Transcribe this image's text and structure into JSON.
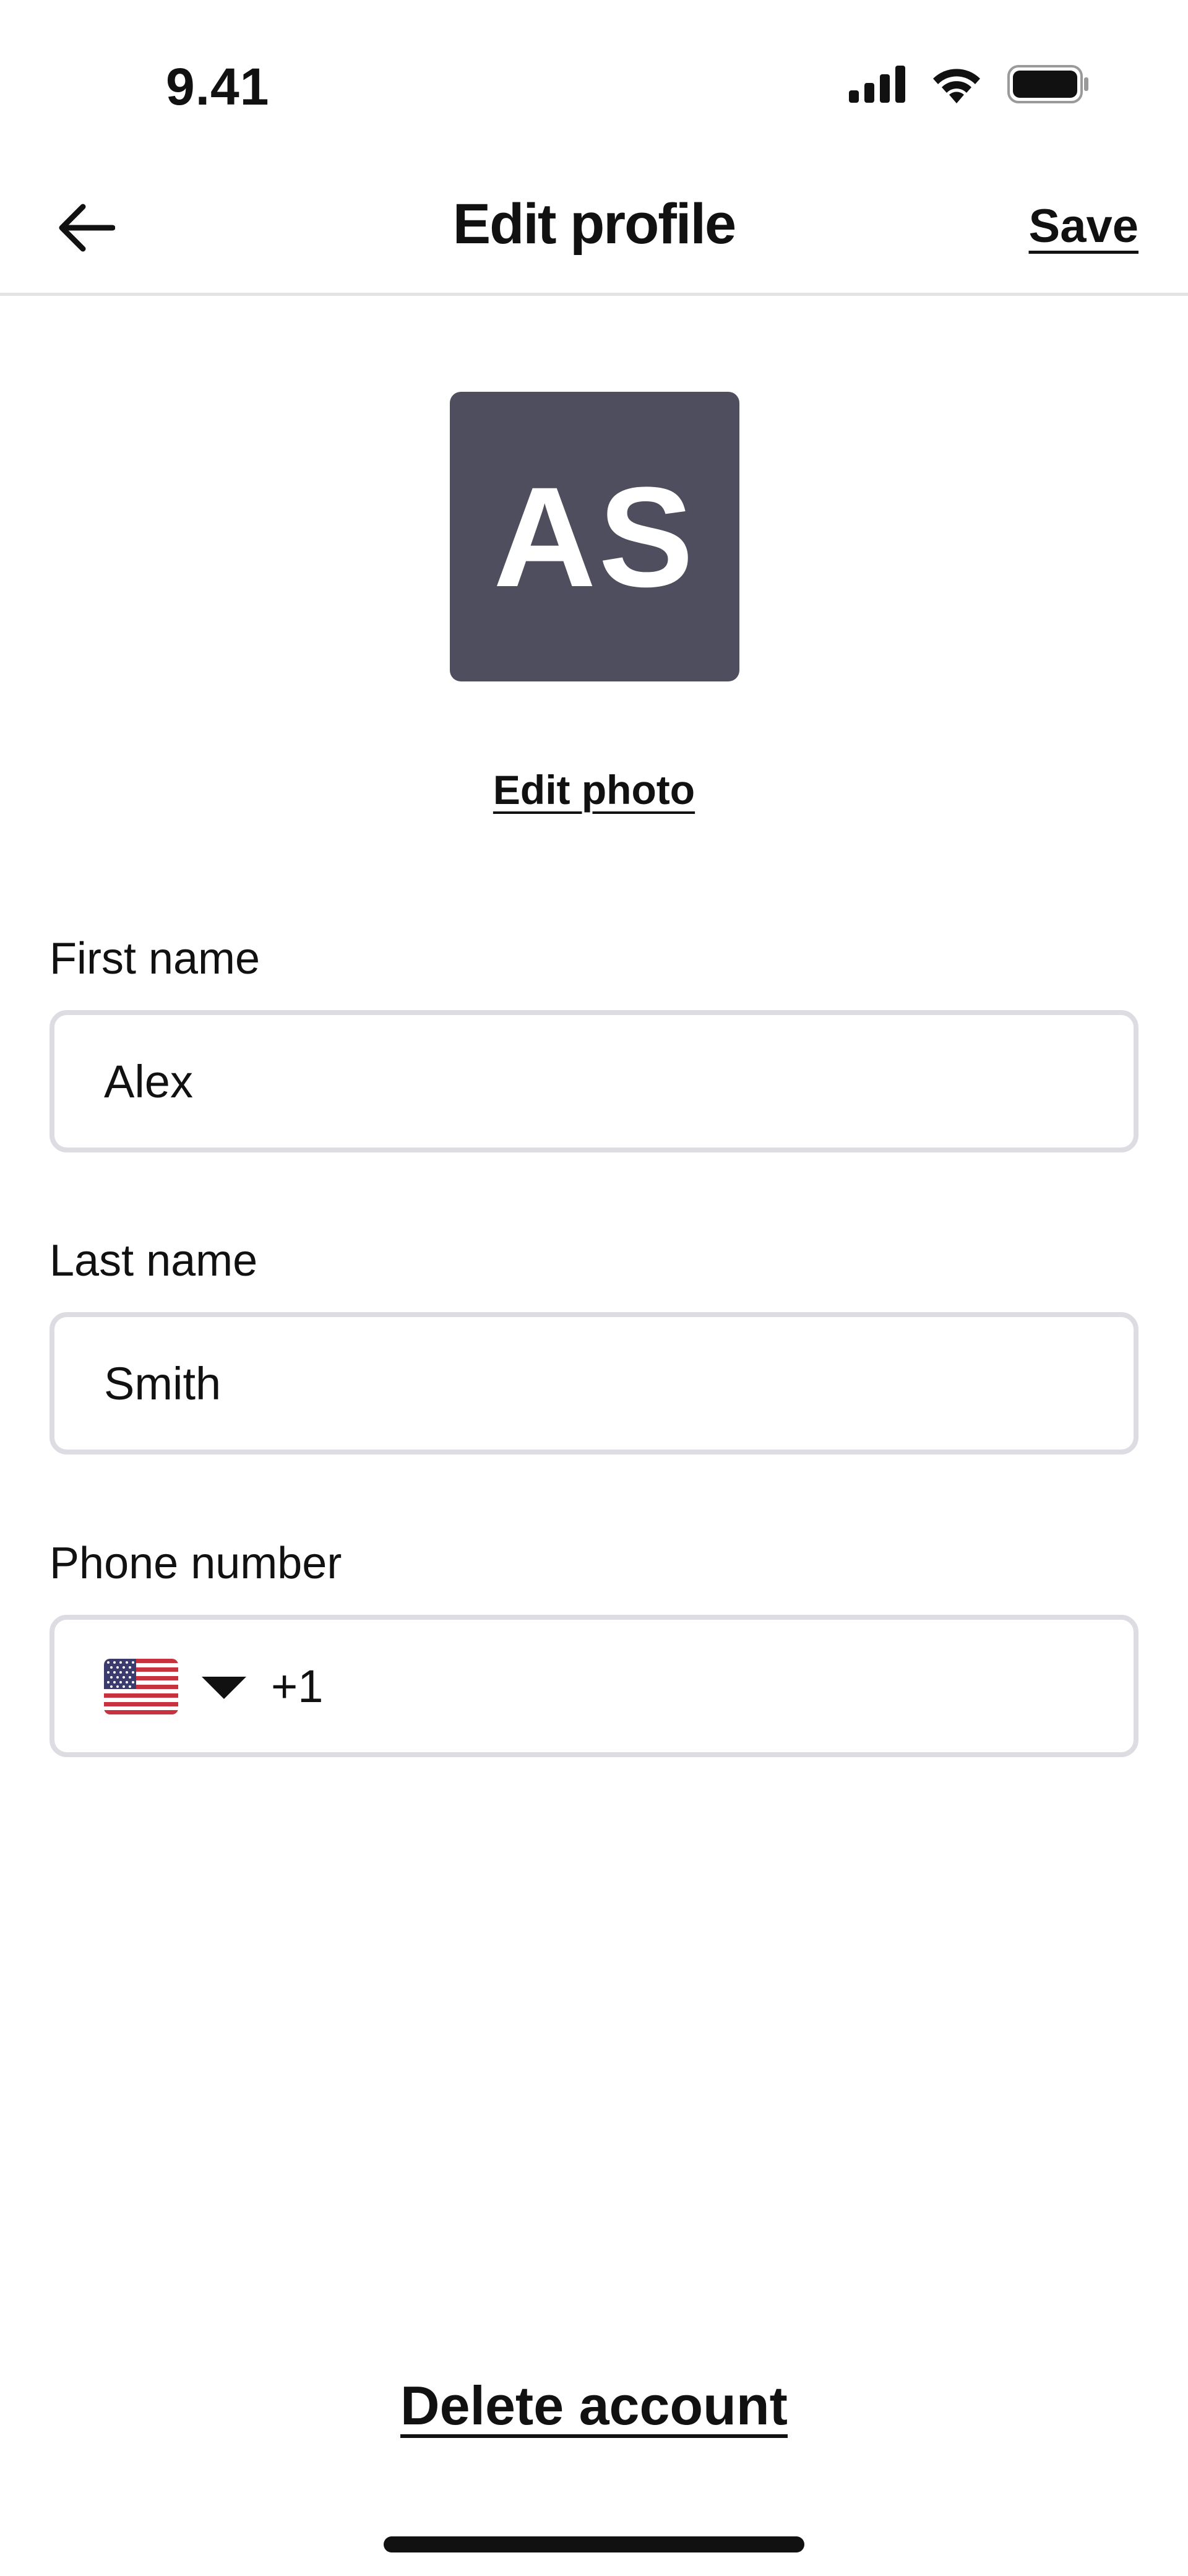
{
  "status_bar": {
    "time": "9.41",
    "icons": [
      "signal-icon",
      "wifi-icon",
      "battery-icon"
    ]
  },
  "header": {
    "title": "Edit profile",
    "save_label": "Save",
    "back_icon": "arrow-left-icon"
  },
  "avatar": {
    "initials": "AS",
    "background": "#4e4e5e",
    "edit_label": "Edit photo"
  },
  "form": {
    "first_name": {
      "label": "First name",
      "value": "Alex"
    },
    "last_name": {
      "label": "Last name",
      "value": "Smith"
    },
    "phone": {
      "label": "Phone number",
      "country_flag": "us-flag-icon",
      "value": "+1"
    }
  },
  "footer": {
    "delete_label": "Delete account"
  },
  "colors": {
    "text": "#111111",
    "border": "#dcdce2",
    "divider": "#e3e3e6"
  }
}
